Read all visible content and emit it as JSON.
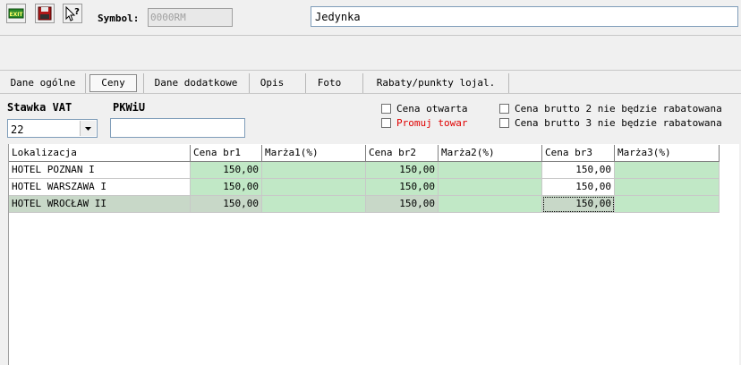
{
  "toolbar": {
    "exit_label": "EXIT",
    "save_icon": "floppy-disk-icon",
    "help_icon": "help-pointer-icon",
    "symbol_label": "Symbol:",
    "symbol_value": "0000RM",
    "name_value": "Jedynka"
  },
  "tabs": [
    {
      "label": "Dane ogólne",
      "active": false
    },
    {
      "label": "Ceny",
      "active": true
    },
    {
      "label": "Dane dodatkowe",
      "active": false
    },
    {
      "label": "Opis",
      "active": false
    },
    {
      "label": "Foto",
      "active": false
    },
    {
      "label": "Rabaty/punkty lojal.",
      "active": false
    }
  ],
  "vat": {
    "stawka_label": "Stawka VAT",
    "stawka_value": "22",
    "pkwiu_label": "PKWiU",
    "pkwiu_value": ""
  },
  "checkboxes": {
    "cena_otwarta": {
      "label": "Cena otwarta",
      "checked": false
    },
    "promuj_towar": {
      "label": "Promuj towar",
      "checked": false,
      "color": "#e00000"
    },
    "brutto2": {
      "label": "Cena brutto 2 nie będzie rabatowana",
      "checked": false
    },
    "brutto3": {
      "label": "Cena brutto 3 nie będzie rabatowana",
      "checked": false
    }
  },
  "table": {
    "columns": [
      "Lokalizacja",
      "Cena br1",
      "Marża1(%)",
      "Cena br2",
      "Marża2(%)",
      "Cena br3",
      "Marża3(%)"
    ],
    "rows": [
      {
        "loc": "HOTEL POZNAN I",
        "br1": "150,00",
        "m1": "",
        "br2": "150,00",
        "m2": "",
        "br3": "150,00",
        "m3": ""
      },
      {
        "loc": "HOTEL WARSZAWA I",
        "br1": "150,00",
        "m1": "",
        "br2": "150,00",
        "m2": "",
        "br3": "150,00",
        "m3": ""
      },
      {
        "loc": "HOTEL WROCŁAW II",
        "br1": "150,00",
        "m1": "",
        "br2": "150,00",
        "m2": "",
        "br3": "150,00",
        "m3": ""
      }
    ],
    "selected_row": 2,
    "colors": {
      "green": "#c1e8c6",
      "header": "#ffffff"
    }
  }
}
